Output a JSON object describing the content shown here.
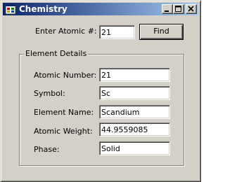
{
  "window": {
    "title": "Chemistry",
    "icons": {
      "app": "app-icon",
      "minimize": "minimize-icon",
      "maximize": "maximize-icon",
      "close": "close-icon"
    }
  },
  "search": {
    "label": "Enter Atomic #:",
    "value": "21",
    "button_label": "Find"
  },
  "details": {
    "group_title": "Element Details",
    "fields": [
      {
        "label": "Atomic Number:",
        "value": "21"
      },
      {
        "label": "Symbol:",
        "value": "Sc"
      },
      {
        "label": "Element Name:",
        "value": "Scandium"
      },
      {
        "label": "Atomic Weight:",
        "value": "44.9559085"
      },
      {
        "label": "Phase:",
        "value": "Solid"
      }
    ]
  },
  "colors": {
    "title_start": "#0a246a",
    "title_end": "#a6caf0",
    "face": "#d4d0c8"
  }
}
